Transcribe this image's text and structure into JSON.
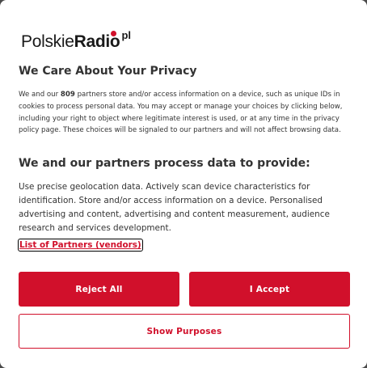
{
  "logo": {
    "part1": "Polskie",
    "part2": "Radio",
    "part3": "pl"
  },
  "dialog": {
    "title": "We Care About Your Privacy",
    "intro_before": "We and our ",
    "partner_count": "809",
    "intro_after": " partners store and/or access information on a device, such as unique IDs in cookies to process personal data. You may accept or manage your choices by clicking below, including your right to object where legitimate interest is used, or at any time in the privacy policy page. These choices will be signaled to our partners and will not affect browsing data.",
    "subtitle": "We and our partners process data to provide:",
    "purposes_text": "Use precise geolocation data. Actively scan device characteristics for identification. Store and/or access information on a device. Personalised advertising and content, advertising and content measurement, audience research and services development.",
    "partners_link": "List of Partners (vendors)"
  },
  "buttons": {
    "reject": "Reject All",
    "accept": "I Accept",
    "show_purposes": "Show Purposes"
  },
  "colors": {
    "accent": "#d1102b",
    "text": "#333333",
    "background": "#ffffff"
  }
}
